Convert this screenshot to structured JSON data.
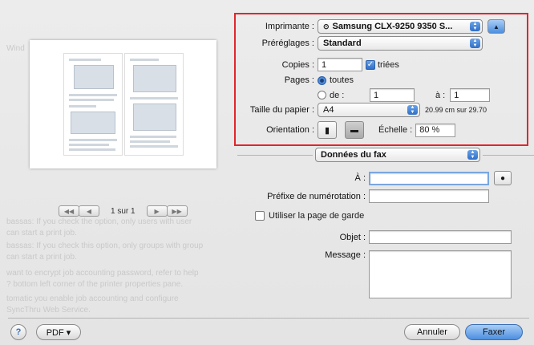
{
  "printer": {
    "label": "Imprimante :",
    "value": "Samsung CLX-9250 9350 S..."
  },
  "presets": {
    "label": "Préréglages :",
    "value": "Standard"
  },
  "copies": {
    "label": "Copies :",
    "value": "1",
    "collate_label": "triées"
  },
  "pages": {
    "label": "Pages :",
    "all_label": "toutes",
    "from_label": "de :",
    "from_value": "1",
    "to_label": "à :",
    "to_value": "1"
  },
  "paper": {
    "label": "Taille du papier :",
    "value": "A4",
    "size_text": "20.99 cm sur 29.70"
  },
  "orientation": {
    "label": "Orientation :"
  },
  "scale": {
    "label": "Échelle :",
    "value": "80 %"
  },
  "section": {
    "value": "Données du fax"
  },
  "fax": {
    "to_label": "À :",
    "prefix_label": "Préfixe de numérotation :",
    "cover_label": "Utiliser la page de garde",
    "subject_label": "Objet :",
    "message_label": "Message :"
  },
  "pager": {
    "label": "1 sur 1"
  },
  "footer": {
    "help": "?",
    "pdf_label": "PDF ▾",
    "cancel_label": "Annuler",
    "fax_label": "Faxer"
  }
}
